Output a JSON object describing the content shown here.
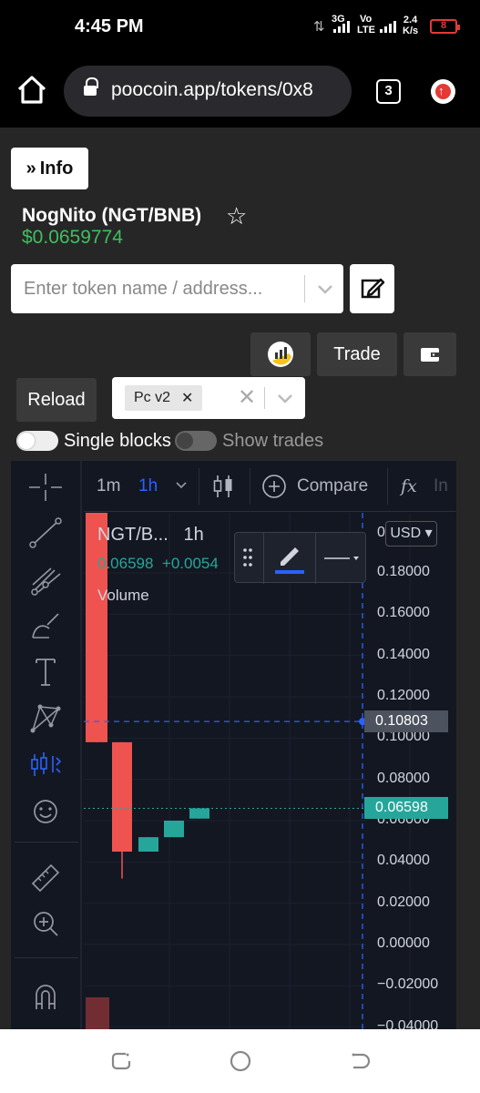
{
  "status": {
    "time": "4:45 PM",
    "net1": "3G",
    "net2": "Vo",
    "net3": "LTE",
    "speed_value": "2.4",
    "speed_unit": "K/s",
    "battery": "8"
  },
  "browser": {
    "url": "poocoin.app/tokens/0x8",
    "tab_count": "3"
  },
  "page": {
    "info_label": "Info",
    "token_name": "NogNito (NGT/BNB)",
    "price": "$0.0659774",
    "search_placeholder": "Enter token name / address...",
    "trade_label": "Trade",
    "reload_label": "Reload",
    "version_chip": "Pc v2",
    "single_blocks_label": "Single blocks",
    "show_trades_label": "Show trades"
  },
  "chart_toolbar": {
    "interval_1m": "1m",
    "interval_1h": "1h",
    "compare_label": "Compare",
    "indicators_label": "In"
  },
  "chart_data": {
    "type": "candlestick",
    "symbol": "NGT/B...",
    "interval": "1h",
    "last_value": "0.06598",
    "change": "+0.0054",
    "volume_label": "Volume",
    "currency": "USD",
    "y_ticks": [
      "0.18000",
      "0.16000",
      "0.14000",
      "0.12000",
      "0.10000",
      "0.08000",
      "0.06000",
      "0.04000",
      "0.02000",
      "0.00000",
      "−0.02000",
      "−0.04000"
    ],
    "y_tick_values": [
      0.18,
      0.16,
      0.14,
      0.12,
      0.1,
      0.08,
      0.06,
      0.04,
      0.02,
      0.0,
      -0.02,
      -0.04
    ],
    "top_tick_partial": "0",
    "ylim": [
      -0.045,
      0.195
    ],
    "crosshair_price": "0.10803",
    "crosshair_value": 0.10803,
    "last_price_label": "0.06598",
    "last_price_value": 0.06598,
    "candles": [
      {
        "open": 0.23,
        "high": 0.23,
        "low": 0.098,
        "close": 0.098,
        "color": "down"
      },
      {
        "open": 0.098,
        "high": 0.098,
        "low": 0.032,
        "close": 0.045,
        "color": "down"
      },
      {
        "open": 0.045,
        "high": 0.052,
        "low": 0.045,
        "close": 0.052,
        "color": "up"
      },
      {
        "open": 0.052,
        "high": 0.06,
        "low": 0.052,
        "close": 0.06,
        "color": "up"
      },
      {
        "open": 0.061,
        "high": 0.066,
        "low": 0.061,
        "close": 0.066,
        "color": "up"
      }
    ],
    "colors": {
      "up": "#26a69a",
      "down": "#ef5350",
      "crosshair": "#2962ff",
      "background": "#131722"
    }
  }
}
